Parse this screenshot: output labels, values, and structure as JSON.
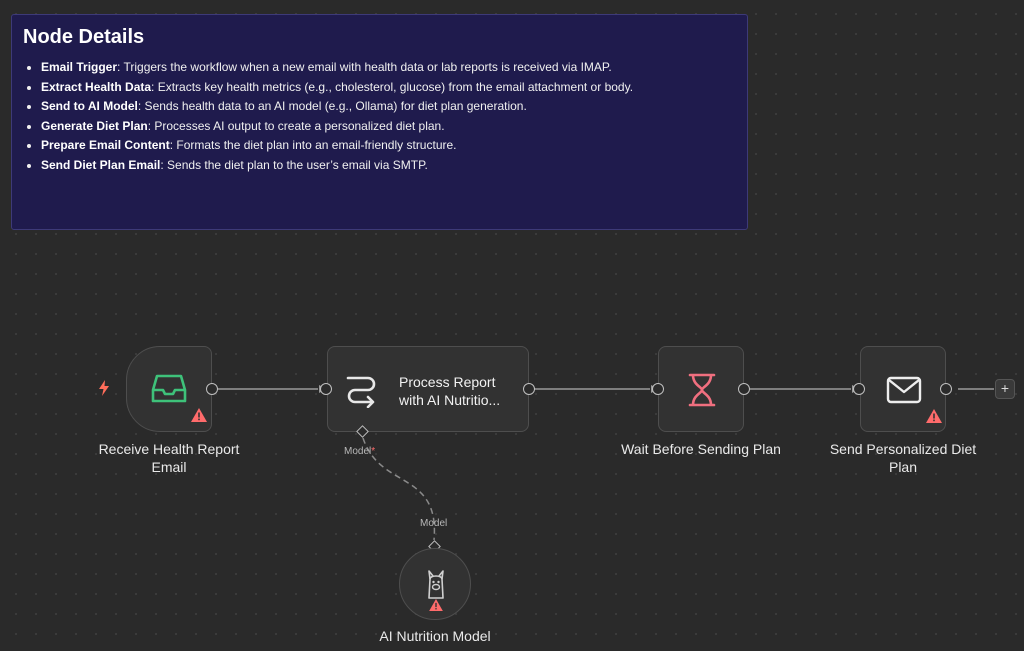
{
  "sticky": {
    "title": "Node Details",
    "items": [
      {
        "term": "Email Trigger",
        "desc": ": Triggers the workflow when a new email with health data or lab reports is received via IMAP."
      },
      {
        "term": "Extract Health Data",
        "desc": ": Extracts key health metrics (e.g., cholesterol, glucose) from the email attachment or body."
      },
      {
        "term": "Send to AI Model",
        "desc": ": Sends health data to an AI model (e.g., Ollama) for diet plan generation."
      },
      {
        "term": "Generate Diet Plan",
        "desc": ": Processes AI output to create a personalized diet plan."
      },
      {
        "term": "Prepare Email Content",
        "desc": ": Formats the diet plan into an email-friendly structure."
      },
      {
        "term": "Send Diet Plan Email",
        "desc": ": Sends the diet plan to the user’s email via SMTP."
      }
    ]
  },
  "nodes": {
    "trigger": {
      "label": "Receive Health Report Email",
      "icon": "inbox-icon"
    },
    "agent": {
      "title_line1": "Process Report",
      "title_line2": "with AI Nutritio...",
      "icon": "agent-route-icon",
      "input_label": "Model",
      "required_mark": "*"
    },
    "wait": {
      "label": "Wait Before Sending Plan",
      "icon": "hourglass-icon"
    },
    "send": {
      "label": "Send Personalized Diet Plan",
      "icon": "envelope-icon"
    },
    "model": {
      "label": "AI Nutrition Model",
      "icon": "llama-icon",
      "output_label": "Model"
    }
  },
  "canvas": {
    "add_button_label": "+"
  },
  "colors": {
    "background": "#2a2a2a",
    "sticky_bg": "#1f1b4d",
    "node_bg": "#323232",
    "trigger_icon": "#3ec27a",
    "wait_icon": "#f06f7f",
    "warning": "#ff6b6b",
    "bolt": "#ff6d5a"
  }
}
